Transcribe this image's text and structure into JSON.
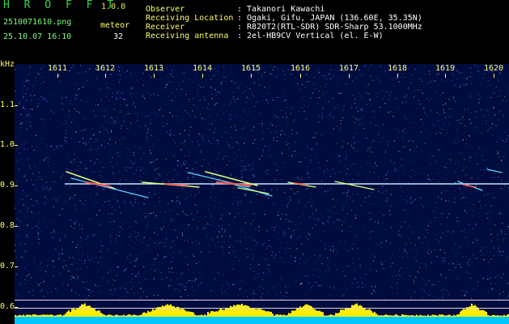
{
  "header": {
    "brand": "H R O F F T",
    "version": "1.0.0",
    "filename": "2510071610.png",
    "meteor_label": "meteor",
    "datetime": "25.10.07 16:10",
    "meteor_count": "32",
    "info": [
      {
        "label": "Observer",
        "value": ": Takanori Kawachi"
      },
      {
        "label": "Receiving Location",
        "value": ": Ogaki, Gifu, JAPAN (136.60E, 35.35N)"
      },
      {
        "label": "Receiver",
        "value": ": R820T2(RTL-SDR) SDR-Sharp 53.1000MHz"
      },
      {
        "label": "Receiving antenna",
        "value": ": 2el-HB9CV Vertical (el. E-W)"
      }
    ]
  },
  "axes": {
    "unit": "kHz",
    "x_ticks": [
      "1611",
      "1612",
      "1613",
      "1614",
      "1615",
      "1616",
      "1617",
      "1618",
      "1619",
      "1620"
    ],
    "y_ticks": [
      "1.1",
      "1.0",
      "0.9",
      "0.8",
      "0.7",
      "0.6"
    ]
  },
  "colors": {
    "background": "#000b3e",
    "carrier_line": "#bfe8ff",
    "echo_core": "#ff5050",
    "echo_mid": "#d8ff7a",
    "echo_outer": "#58d8ff",
    "level_bar": "#ffee00",
    "level_base": "#00c8ff",
    "label_text": "#ffff66",
    "brand_text": "#2fd84a"
  }
}
